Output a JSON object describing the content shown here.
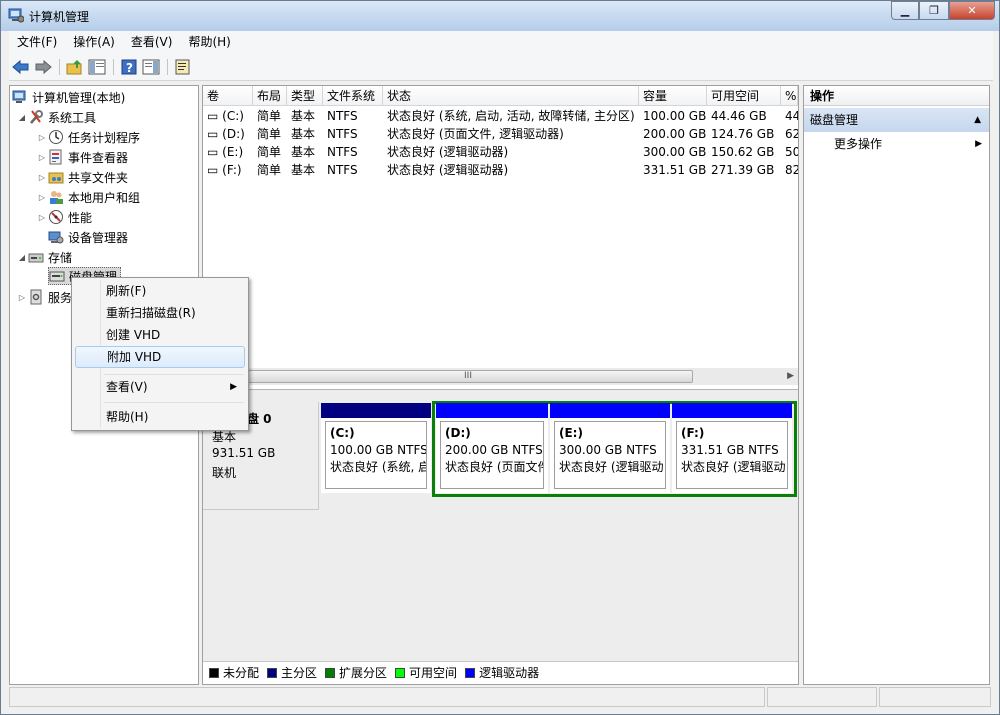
{
  "window": {
    "title": "计算机管理"
  },
  "menubar": [
    "文件(F)",
    "操作(A)",
    "查看(V)",
    "帮助(H)"
  ],
  "tree": {
    "root": "计算机管理(本地)",
    "system_tools": "系统工具",
    "task_scheduler": "任务计划程序",
    "event_viewer": "事件查看器",
    "shared_folders": "共享文件夹",
    "local_users": "本地用户和组",
    "performance": "性能",
    "device_manager": "设备管理器",
    "storage": "存储",
    "disk_management": "磁盘管理",
    "services": "服务"
  },
  "volume_table": {
    "headers": [
      "卷",
      "布局",
      "类型",
      "文件系统",
      "状态",
      "容量",
      "可用空间",
      "%"
    ],
    "rows": [
      [
        "(C:)",
        "简单",
        "基本",
        "NTFS",
        "状态良好 (系统, 启动, 活动, 故障转储, 主分区)",
        "100.00 GB",
        "44.46 GB",
        "44"
      ],
      [
        "(D:)",
        "简单",
        "基本",
        "NTFS",
        "状态良好 (页面文件, 逻辑驱动器)",
        "200.00 GB",
        "124.76 GB",
        "62"
      ],
      [
        "(E:)",
        "简单",
        "基本",
        "NTFS",
        "状态良好 (逻辑驱动器)",
        "300.00 GB",
        "150.62 GB",
        "50"
      ],
      [
        "(F:)",
        "简单",
        "基本",
        "NTFS",
        "状态良好 (逻辑驱动器)",
        "331.51 GB",
        "271.39 GB",
        "82"
      ]
    ]
  },
  "scroll_grip": "III",
  "disk": {
    "name": "盘 0",
    "type": "基本",
    "size": "931.51 GB",
    "status": "联机",
    "partitions": [
      {
        "label": "(C:)",
        "size": "100.00 GB NTFS",
        "status": "状态良好 (系统, 启",
        "bar_color": "#000080"
      },
      {
        "label": "(D:)",
        "size": "200.00 GB NTFS",
        "status": "状态良好 (页面文件",
        "bar_color": "#0000ff"
      },
      {
        "label": "(E:)",
        "size": "300.00 GB NTFS",
        "status": "状态良好 (逻辑驱动",
        "bar_color": "#0000ff"
      },
      {
        "label": "(F:)",
        "size": "331.51 GB NTFS",
        "status": "状态良好 (逻辑驱动",
        "bar_color": "#0000ff"
      }
    ]
  },
  "legend": [
    {
      "label": "未分配",
      "color": "#000000"
    },
    {
      "label": "主分区",
      "color": "#000080"
    },
    {
      "label": "扩展分区",
      "color": "#008000"
    },
    {
      "label": "可用空间",
      "color": "#00ff00"
    },
    {
      "label": "逻辑驱动器",
      "color": "#0000ff"
    }
  ],
  "actions": {
    "header": "操作",
    "section": "磁盘管理",
    "more": "更多操作"
  },
  "context_menu": {
    "refresh": "刷新(F)",
    "rescan": "重新扫描磁盘(R)",
    "create_vhd": "创建 VHD",
    "attach_vhd": "附加 VHD",
    "view": "查看(V)",
    "help": "帮助(H)"
  },
  "colors": {
    "extended_frame": "#0a800a",
    "selection": "#3399ff"
  }
}
